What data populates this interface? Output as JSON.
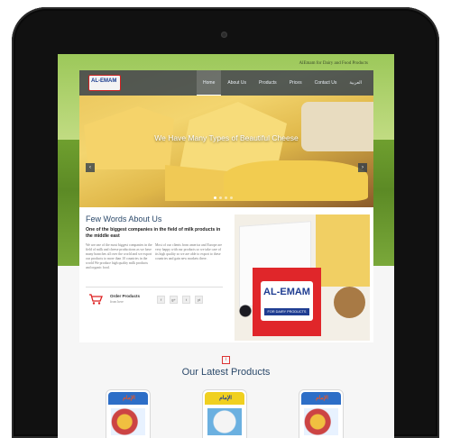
{
  "site": {
    "top_left_text": "",
    "top_right_text": "AlEmam for Dairy and Food Products",
    "logo_text": "AL-EMAM"
  },
  "nav": {
    "items": [
      {
        "label": "Home",
        "active": true
      },
      {
        "label": "About Us",
        "active": false
      },
      {
        "label": "Products",
        "active": false
      },
      {
        "label": "Prices",
        "active": false
      },
      {
        "label": "Contact Us",
        "active": false
      },
      {
        "label": "العربية",
        "active": false
      }
    ]
  },
  "hero": {
    "title": "We Have Many Types of Beautiful Cheese",
    "prev_arrow": "‹",
    "next_arrow": "›",
    "dots": 4,
    "active_dot": 0
  },
  "about": {
    "heading": "Few Words About Us",
    "lead": "One of the biggest companies in the field of milk products in the middle east",
    "paragraph_1": "We are one of the most biggest companies in the field of milk and cheese productions as we have many branches all over the world and we export our products to more than 10 countries in the world We produce high quality milk products and organic food.",
    "paragraph_2": "Most of our clients from america and Europe are very happy with our products so we take care of its high quality so we are able to export to these countries and gain new markets there.",
    "order_title": "Order Products",
    "order_sub": "from here",
    "social": [
      "f",
      "g+",
      "t",
      "yt"
    ]
  },
  "badge": {
    "name": "AL-EMAM",
    "tag": "FOR DAIRY PRODUCTS"
  },
  "latest": {
    "icon": "i",
    "title": "Our Latest Products"
  },
  "products": [
    {
      "label": "الإمام"
    },
    {
      "label": "الإمام"
    },
    {
      "label": "الإمام"
    }
  ]
}
